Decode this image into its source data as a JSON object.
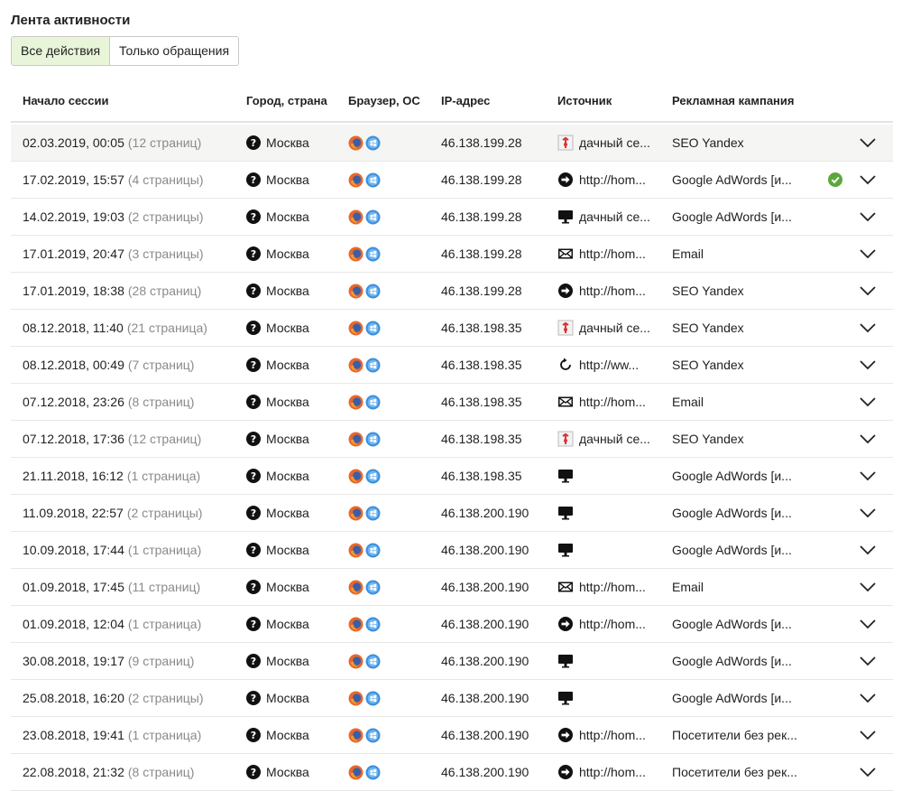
{
  "page": {
    "title": "Лента активности"
  },
  "tabs": {
    "all": "Все действия",
    "requests": "Только обращения"
  },
  "columns": {
    "session_start": "Начало сессии",
    "city": "Город, страна",
    "browser": "Браузер, ОС",
    "ip": "IP-адрес",
    "source": "Источник",
    "campaign": "Рекламная кампания"
  },
  "rows": [
    {
      "date": "02.03.2019, 00:05",
      "pages": "(12 страниц)",
      "city": "Москва",
      "ip": "46.138.199.28",
      "source_icon": "bookmark-icon",
      "source": "дачный се...",
      "campaign": "SEO Yandex",
      "check": false
    },
    {
      "date": "17.02.2019, 15:57",
      "pages": "(4 страницы)",
      "city": "Москва",
      "ip": "46.138.199.28",
      "source_icon": "arrow-icon",
      "source": "http://hom...",
      "campaign": "Google AdWords [и...",
      "check": true
    },
    {
      "date": "14.02.2019, 19:03",
      "pages": "(2 страницы)",
      "city": "Москва",
      "ip": "46.138.199.28",
      "source_icon": "monitor-icon",
      "source": "дачный се...",
      "campaign": "Google AdWords [и...",
      "check": false
    },
    {
      "date": "17.01.2019, 20:47",
      "pages": "(3 страницы)",
      "city": "Москва",
      "ip": "46.138.199.28",
      "source_icon": "mail-icon",
      "source": "http://hom...",
      "campaign": "Email",
      "check": false
    },
    {
      "date": "17.01.2019, 18:38",
      "pages": "(28 страниц)",
      "city": "Москва",
      "ip": "46.138.199.28",
      "source_icon": "arrow-icon",
      "source": "http://hom...",
      "campaign": "SEO Yandex",
      "check": false
    },
    {
      "date": "08.12.2018, 11:40",
      "pages": "(21 страница)",
      "city": "Москва",
      "ip": "46.138.198.35",
      "source_icon": "bookmark-icon",
      "source": "дачный се...",
      "campaign": "SEO Yandex",
      "check": false
    },
    {
      "date": "08.12.2018, 00:49",
      "pages": "(7 страниц)",
      "city": "Москва",
      "ip": "46.138.198.35",
      "source_icon": "refresh-icon",
      "source": "http://ww...",
      "campaign": "SEO Yandex",
      "check": false
    },
    {
      "date": "07.12.2018, 23:26",
      "pages": "(8 страниц)",
      "city": "Москва",
      "ip": "46.138.198.35",
      "source_icon": "mail-icon",
      "source": "http://hom...",
      "campaign": "Email",
      "check": false
    },
    {
      "date": "07.12.2018, 17:36",
      "pages": "(12 страниц)",
      "city": "Москва",
      "ip": "46.138.198.35",
      "source_icon": "bookmark-icon",
      "source": "дачный се...",
      "campaign": "SEO Yandex",
      "check": false
    },
    {
      "date": "21.11.2018, 16:12",
      "pages": "(1 страница)",
      "city": "Москва",
      "ip": "46.138.198.35",
      "source_icon": "monitor-icon",
      "source": "",
      "campaign": "Google AdWords [и...",
      "check": false
    },
    {
      "date": "11.09.2018, 22:57",
      "pages": "(2 страницы)",
      "city": "Москва",
      "ip": "46.138.200.190",
      "source_icon": "monitor-icon",
      "source": "",
      "campaign": "Google AdWords [и...",
      "check": false
    },
    {
      "date": "10.09.2018, 17:44",
      "pages": "(1 страница)",
      "city": "Москва",
      "ip": "46.138.200.190",
      "source_icon": "monitor-icon",
      "source": "",
      "campaign": "Google AdWords [и...",
      "check": false
    },
    {
      "date": "01.09.2018, 17:45",
      "pages": "(11 страниц)",
      "city": "Москва",
      "ip": "46.138.200.190",
      "source_icon": "mail-icon",
      "source": "http://hom...",
      "campaign": "Email",
      "check": false
    },
    {
      "date": "01.09.2018, 12:04",
      "pages": "(1 страница)",
      "city": "Москва",
      "ip": "46.138.200.190",
      "source_icon": "arrow-icon",
      "source": "http://hom...",
      "campaign": "Google AdWords [и...",
      "check": false
    },
    {
      "date": "30.08.2018, 19:17",
      "pages": "(9 страниц)",
      "city": "Москва",
      "ip": "46.138.200.190",
      "source_icon": "monitor-icon",
      "source": "",
      "campaign": "Google AdWords [и...",
      "check": false
    },
    {
      "date": "25.08.2018, 16:20",
      "pages": "(2 страницы)",
      "city": "Москва",
      "ip": "46.138.200.190",
      "source_icon": "monitor-icon",
      "source": "",
      "campaign": "Google AdWords [и...",
      "check": false
    },
    {
      "date": "23.08.2018, 19:41",
      "pages": "(1 страница)",
      "city": "Москва",
      "ip": "46.138.200.190",
      "source_icon": "arrow-icon",
      "source": "http://hom...",
      "campaign": "Посетители без рек...",
      "check": false
    },
    {
      "date": "22.08.2018, 21:32",
      "pages": "(8 страниц)",
      "city": "Москва",
      "ip": "46.138.200.190",
      "source_icon": "arrow-icon",
      "source": "http://hom...",
      "campaign": "Посетители без рек...",
      "check": false
    }
  ],
  "colors": {
    "active_tab": "#e8f5d9",
    "check": "#5aa83a",
    "muted": "#8a8a8a"
  }
}
